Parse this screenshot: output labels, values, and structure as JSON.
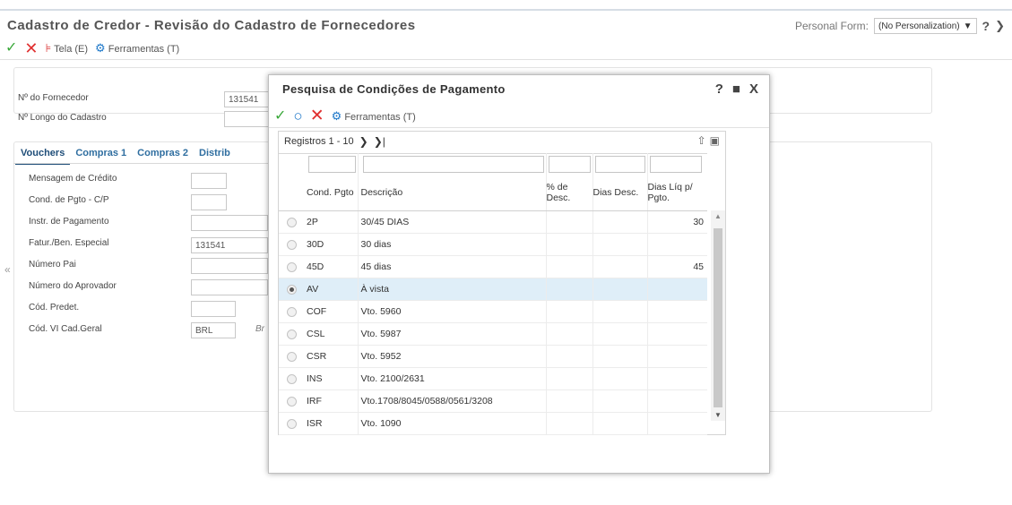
{
  "app": {
    "title": "Cadastro de Credor - Revisão do Cadastro de Fornecedores",
    "personal_form_label": "Personal Form:",
    "personal_form_value": "(No Personalization)",
    "help": "?",
    "close": "X"
  },
  "toolbar": {
    "tela_label": "Tela (E)",
    "ferramentas_label": "Ferramentas (T)"
  },
  "header_fields": [
    {
      "label": "Nº do Fornecedor",
      "value": "131541"
    },
    {
      "label": "Nº Longo do Cadastro",
      "value": ""
    }
  ],
  "tabs": [
    "Vouchers",
    "Compras 1",
    "Compras 2",
    "Distrib"
  ],
  "form_fields": [
    {
      "label": "Mensagem de Crédito",
      "value": ""
    },
    {
      "label": "Cond. de Pgto - C/P",
      "value": ""
    },
    {
      "label": "Instr. de Pagamento",
      "value": ""
    },
    {
      "label": "Fatur./Ben. Especial",
      "value": "131541"
    },
    {
      "label": "Número Pai",
      "value": ""
    },
    {
      "label": "Número do Aprovador",
      "value": ""
    },
    {
      "label": "Cód. Predet.",
      "value": ""
    },
    {
      "label": "Cód. VI Cad.Geral",
      "value": "BRL",
      "extra": "Br"
    }
  ],
  "modal": {
    "title": "Pesquisa de Condições de Pagamento",
    "ferramentas_label": "Ferramentas (T)",
    "pager_text": "Registros 1 - 10",
    "columns": [
      "Cond. Pgto",
      "Descrição",
      "% de Desc.",
      "Dias Desc.",
      "Dias Líq p/ Pgto."
    ],
    "rows": [
      {
        "code": "2P",
        "desc": "30/45 DIAS",
        "pct": "",
        "dias_desc": "",
        "dias_liq": "30",
        "selected": false
      },
      {
        "code": "30D",
        "desc": "30 dias",
        "pct": "",
        "dias_desc": "",
        "dias_liq": "",
        "selected": false
      },
      {
        "code": "45D",
        "desc": "45 dias",
        "pct": "",
        "dias_desc": "",
        "dias_liq": "45",
        "selected": false
      },
      {
        "code": "AV",
        "desc": "À vista",
        "pct": "",
        "dias_desc": "",
        "dias_liq": "",
        "selected": true
      },
      {
        "code": "COF",
        "desc": "Vto. 5960",
        "pct": "",
        "dias_desc": "",
        "dias_liq": "",
        "selected": false
      },
      {
        "code": "CSL",
        "desc": "Vto. 5987",
        "pct": "",
        "dias_desc": "",
        "dias_liq": "",
        "selected": false
      },
      {
        "code": "CSR",
        "desc": "Vto. 5952",
        "pct": "",
        "dias_desc": "",
        "dias_liq": "",
        "selected": false
      },
      {
        "code": "INS",
        "desc": "Vto. 2100/2631",
        "pct": "",
        "dias_desc": "",
        "dias_liq": "",
        "selected": false
      },
      {
        "code": "IRF",
        "desc": "Vto.1708/8045/0588/0561/3208",
        "pct": "",
        "dias_desc": "",
        "dias_liq": "",
        "selected": false
      },
      {
        "code": "ISR",
        "desc": "Vto. 1090",
        "pct": "",
        "dias_desc": "",
        "dias_liq": "",
        "selected": false
      }
    ]
  },
  "colors": {
    "accent_blue": "#1b76c8",
    "ok_green": "#3aa83a",
    "cancel_red": "#e03030",
    "selected_row": "#dfeef8"
  }
}
